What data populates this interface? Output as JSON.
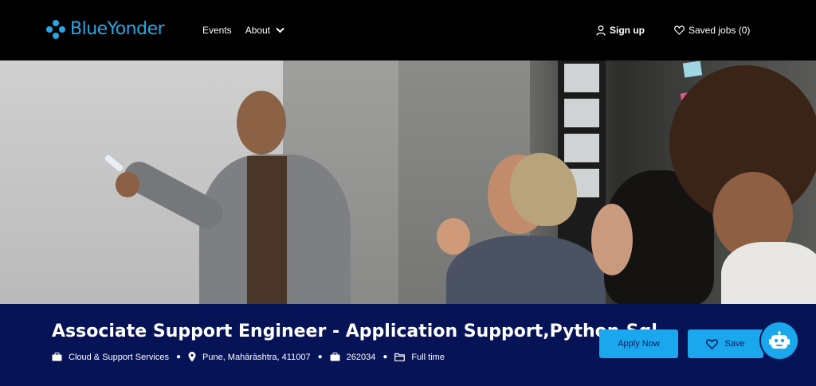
{
  "header": {
    "logo_text": "BlueYonder",
    "nav": [
      {
        "label": "Events"
      },
      {
        "label": "About"
      }
    ],
    "sign_up_label": "Sign up",
    "saved_jobs_label": "Saved jobs (0)"
  },
  "job": {
    "title": "Associate Support Engineer - Application Support,Python,Sql",
    "category": "Cloud & Support Services",
    "location": "Pune, Mahārāshtra, 411007",
    "job_id": "262034",
    "type": "Full time"
  },
  "actions": {
    "apply_label": "Apply Now",
    "save_label": "Save"
  },
  "colors": {
    "brand": "#27a8e6",
    "banner": "#071357",
    "button": "#1aa7ee"
  },
  "icons": [
    "user-icon",
    "heart-icon",
    "briefcase-icon",
    "map-pin-icon",
    "folder-icon",
    "chatbot-icon",
    "chevron-down-icon"
  ]
}
